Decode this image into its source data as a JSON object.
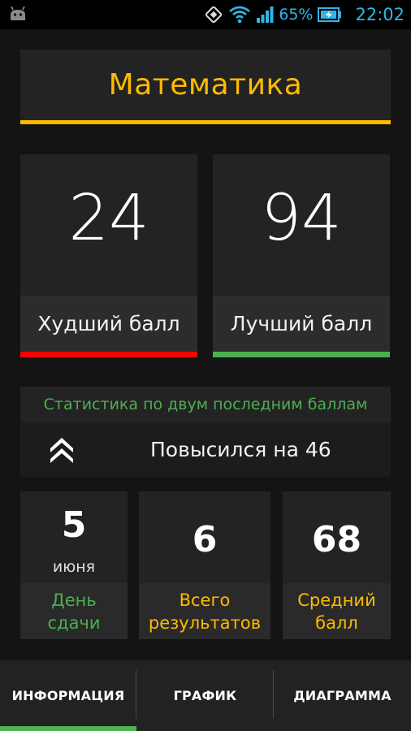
{
  "status_bar": {
    "battery_percent": "65%",
    "time": "22:02",
    "accent_color": "#33b5e5",
    "icons": [
      "android-debug-icon",
      "screen-rotation-icon",
      "wifi-icon",
      "signal-icon",
      "battery-charging-icon"
    ]
  },
  "subject": {
    "title": "Математика",
    "accent_color": "#ffbb00"
  },
  "scores": {
    "worst": {
      "value": "24",
      "label": "Худший балл",
      "color": "#ff0000"
    },
    "best": {
      "value": "94",
      "label": "Лучший балл",
      "color": "#4caf50"
    }
  },
  "stats": {
    "title": "Статистика по двум последним баллам",
    "change_text": "Повысился на 46",
    "icon": "double-chevron-up-icon"
  },
  "cards": {
    "day": {
      "value": "5",
      "sub": "июня",
      "caption": "День\nсдачи",
      "caption_color": "#4caf50"
    },
    "total": {
      "value": "6",
      "caption": "Всего\nрезультатов",
      "caption_color": "#ffbb00"
    },
    "average": {
      "value": "68",
      "caption": "Средний\nбалл",
      "caption_color": "#ffbb00"
    }
  },
  "tabs": [
    {
      "label": "ИНФОРМАЦИЯ",
      "active": true
    },
    {
      "label": "ГРАФИК",
      "active": false
    },
    {
      "label": "ДИАГРАММА",
      "active": false
    }
  ]
}
